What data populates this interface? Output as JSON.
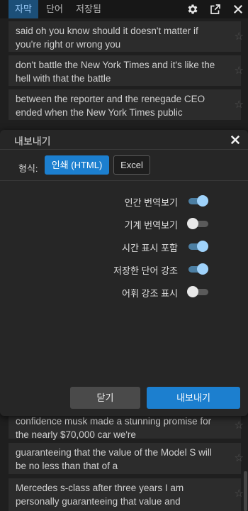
{
  "tabs": [
    {
      "label": "자막",
      "active": true
    },
    {
      "label": "단어",
      "active": false
    },
    {
      "label": "저장됨",
      "active": false
    }
  ],
  "toolbar_icons": [
    "gear-icon",
    "share-export-icon",
    "close-icon"
  ],
  "subtitles": [
    {
      "text": "said oh you know should it doesn't matter if you're right or wrong you"
    },
    {
      "text": "don't battle the New York Times and it's like the hell with that the battle"
    },
    {
      "text": "between the reporter and the renegade CEO ended when the New York Times public"
    },
    {
      "text": "confidence musk made a stunning promise for the nearly $70,000 car we're"
    },
    {
      "text": "guaranteeing that the value of the Model S will be no less than that of a"
    },
    {
      "text": "Mercedes s-class after three years I am personally guaranteeing that value and"
    }
  ],
  "dialog": {
    "title": "내보내기",
    "format_label": "형식:",
    "formats": [
      "인쇄 (HTML)",
      "Excel"
    ],
    "selected_format": "인쇄 (HTML)",
    "options": [
      {
        "label": "인간 번역보기",
        "on": true
      },
      {
        "label": "기계 번역보기",
        "on": false
      },
      {
        "label": "시간 표시 포함",
        "on": true
      },
      {
        "label": "저장한 단어 강조",
        "on": true
      },
      {
        "label": "어휘 강조 표시",
        "on": false
      }
    ],
    "close_button": "닫기",
    "export_button": "내보내기"
  },
  "colors": {
    "accent": "#1c7fcf",
    "toggle_on_knob": "#9fd2fa",
    "background": "#1f1f1f",
    "row_background": "#2c2c2c"
  }
}
